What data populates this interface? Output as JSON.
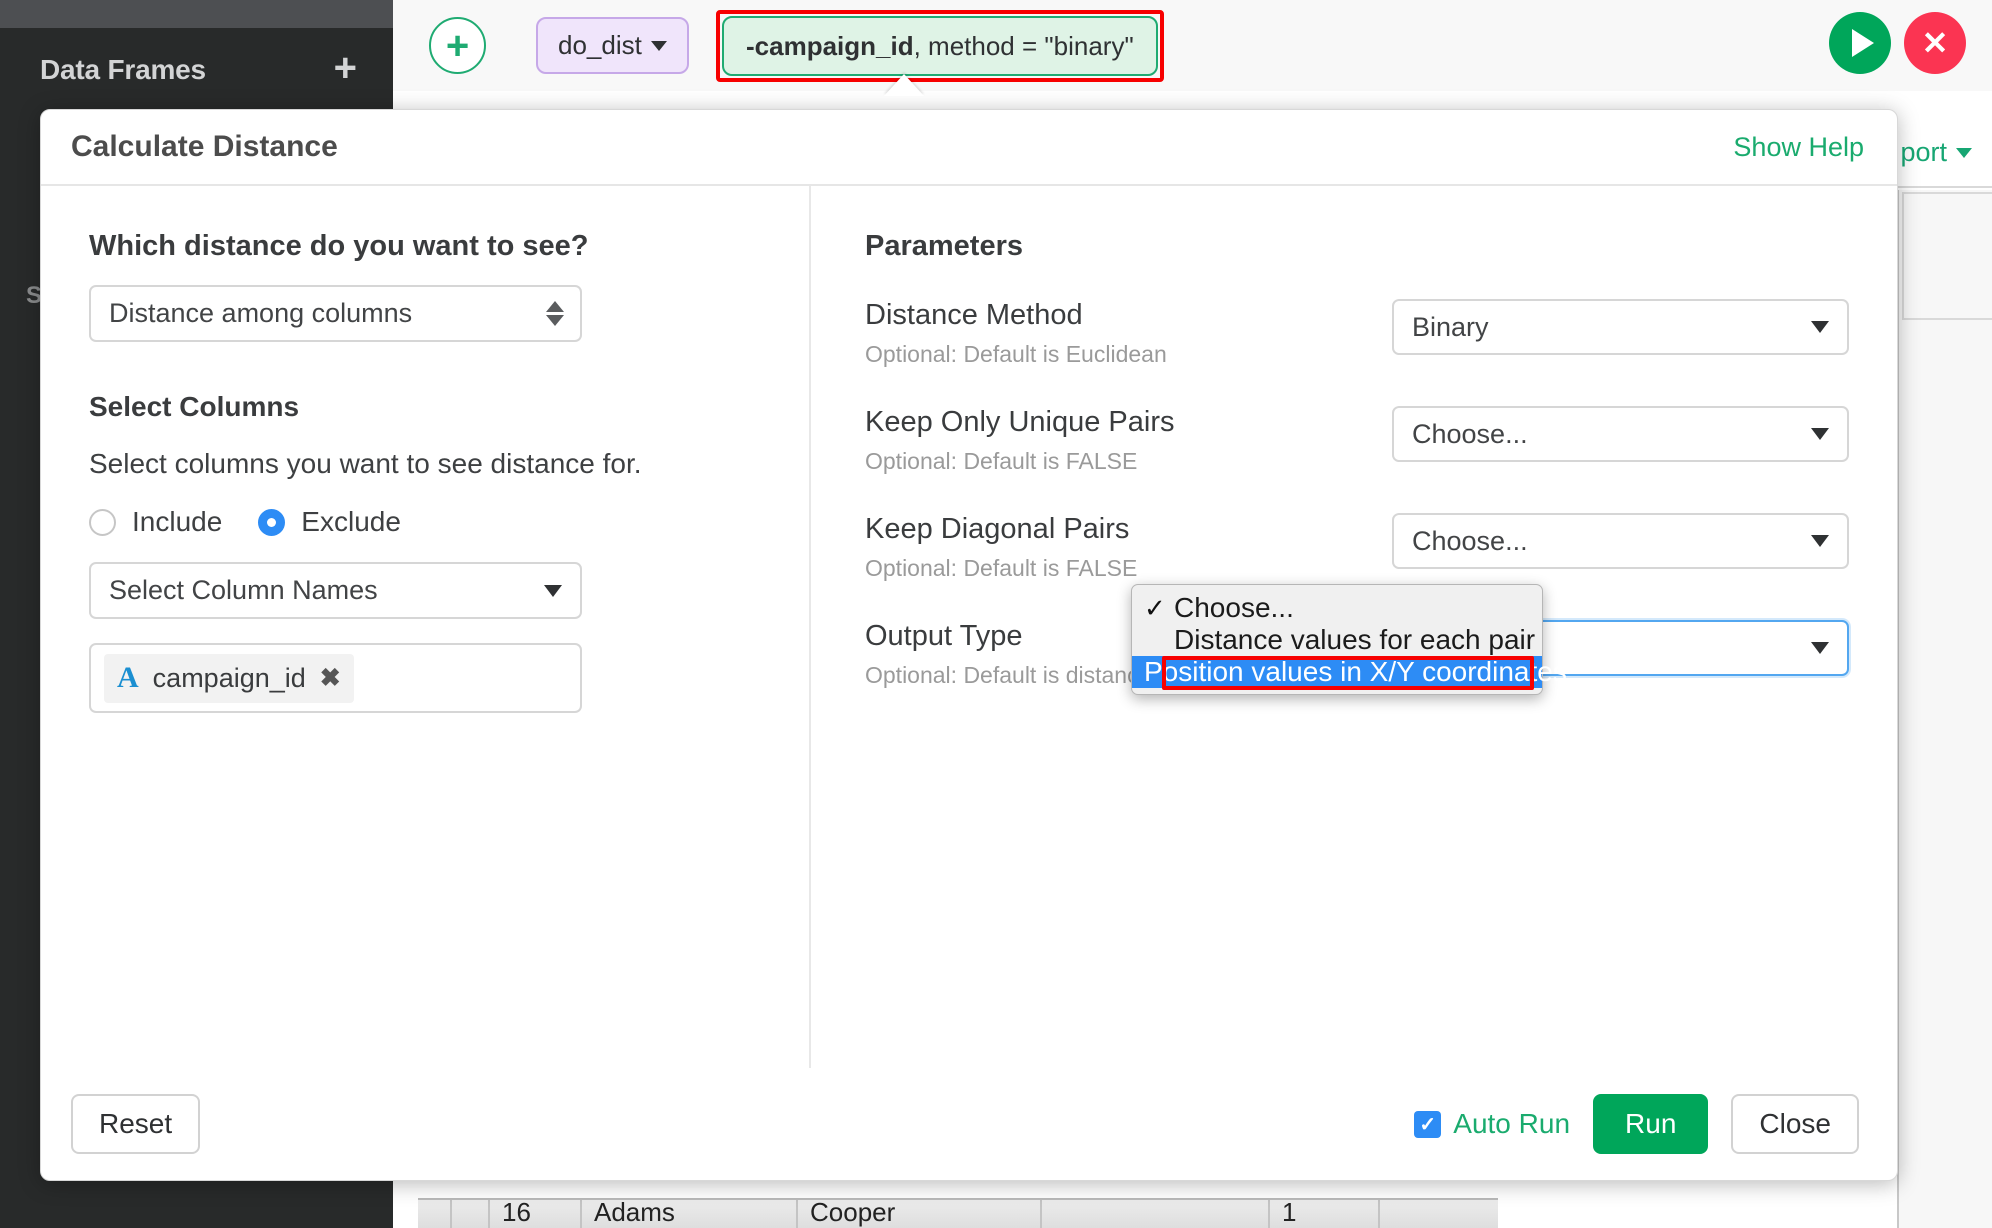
{
  "background": {
    "sidebar": {
      "title": "Data Frames",
      "add_icon": "plus-icon",
      "sub_label": "S"
    },
    "toolbar": {
      "add_icon": "plus-circle-icon",
      "function_chip": "do_dist",
      "args_chip_prefix": "-campaign_id",
      "args_chip_suffix": ", method = \"binary\"",
      "run_icon": "play-icon",
      "stop_icon": "close-icon"
    },
    "export_label": "port",
    "table_row": [
      "",
      "",
      "16",
      "Adams",
      "Cooper",
      "",
      "1",
      ""
    ]
  },
  "modal": {
    "title": "Calculate Distance",
    "help_link": "Show Help",
    "left": {
      "question": "Which distance do you want to see?",
      "distance_select_value": "Distance among columns",
      "section_title": "Select Columns",
      "section_desc": "Select columns you want to see distance for.",
      "radios": [
        {
          "label": "Include",
          "selected": false
        },
        {
          "label": "Exclude",
          "selected": true
        }
      ],
      "column_select_placeholder": "Select Column Names",
      "chips": [
        {
          "type_icon": "text-type-icon",
          "label": "campaign_id",
          "remove_icon": "close-icon"
        }
      ]
    },
    "right": {
      "title": "Parameters",
      "params": [
        {
          "label": "Distance Method",
          "hint": "Optional: Default is Euclidean",
          "value": "Binary",
          "focused": false
        },
        {
          "label": "Keep Only Unique Pairs",
          "hint": "Optional: Default is FALSE",
          "value": "Choose...",
          "focused": false
        },
        {
          "label": "Keep Diagonal Pairs",
          "hint": "Optional: Default is FALSE",
          "value": "Choose...",
          "focused": false
        },
        {
          "label": "Output Type",
          "hint": "Optional: Default is distance values for each pair",
          "value": "Choose...",
          "focused": true
        }
      ],
      "dropdown": {
        "options": [
          {
            "label": "Choose...",
            "checked": true,
            "selected": false
          },
          {
            "label": "Distance values for each pair",
            "checked": false,
            "selected": false
          },
          {
            "label": "Position values in X/Y coordinates",
            "checked": false,
            "selected": true
          }
        ]
      }
    },
    "footer": {
      "reset_label": "Reset",
      "auto_run_label": "Auto Run",
      "auto_run_checked": true,
      "run_label": "Run",
      "close_label": "Close"
    }
  },
  "colors": {
    "accent_green": "#00a65a",
    "link_green": "#1aab6e",
    "select_blue": "#2d8cf5",
    "highlight_red": "#f70000",
    "stop_red": "#fb3452",
    "chip_purple_bg": "#f0e5fb",
    "chip_green_bg": "#dff3e6",
    "sidebar_dark": "#282a2a"
  }
}
